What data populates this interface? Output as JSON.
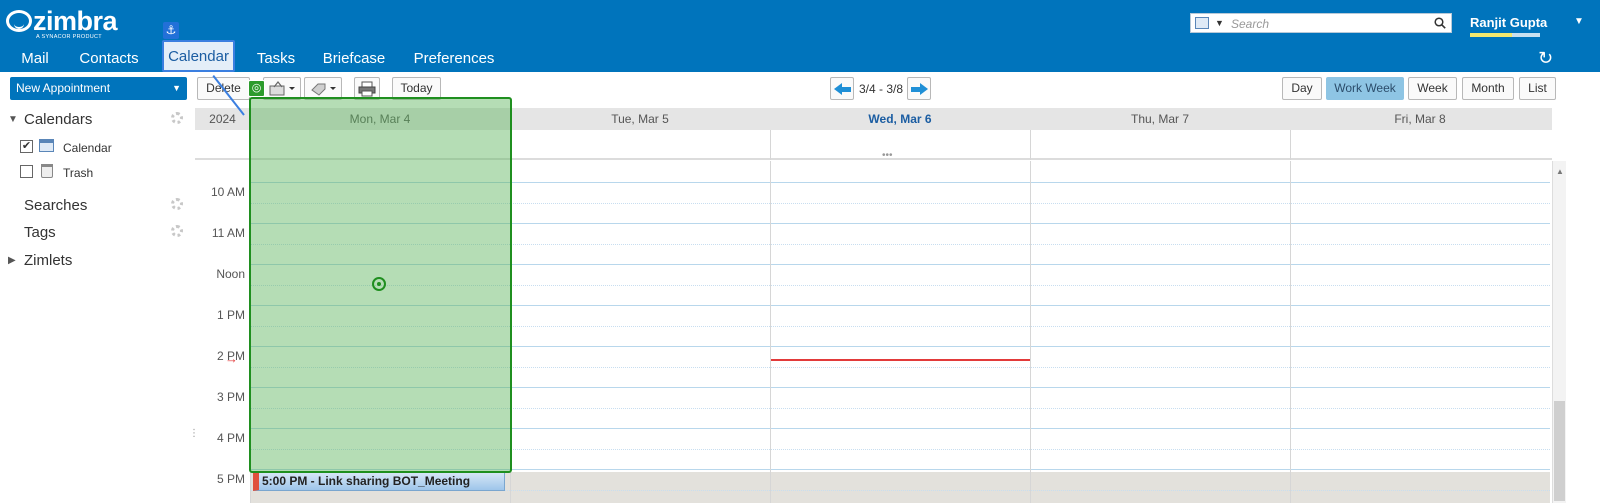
{
  "brand": {
    "name": "zimbra",
    "tagline": "A SYNACOR PRODUCT"
  },
  "header": {
    "search_placeholder": "Search",
    "user_name": "Ranjit Gupta",
    "quota_fraction": 0.6
  },
  "app_tabs": [
    "Mail",
    "Contacts",
    "Calendar",
    "Tasks",
    "Briefcase",
    "Preferences"
  ],
  "active_tab": "Calendar",
  "sidebar": {
    "new_button": "New Appointment",
    "calendars_header": "Calendars",
    "calendars": [
      {
        "label": "Calendar",
        "checked": true
      },
      {
        "label": "Trash",
        "checked": false
      }
    ],
    "searches_header": "Searches",
    "tags_header": "Tags",
    "zimlets_header": "Zimlets"
  },
  "toolbar": {
    "delete": "Delete",
    "today": "Today",
    "date_range": "3/4 - 3/8",
    "views": [
      "Day",
      "Work Week",
      "Week",
      "Month",
      "List"
    ],
    "active_view": "Work Week"
  },
  "calendar": {
    "year": "2024",
    "days": [
      "Mon, Mar 4",
      "Tue, Mar 5",
      "Wed, Mar 6",
      "Thu, Mar 7",
      "Fri, Mar 8"
    ],
    "today": "Wed, Mar 6",
    "hours": [
      "10 AM",
      "11 AM",
      "Noon",
      "1 PM",
      "2 PM",
      "3 PM",
      "4 PM",
      "5 PM"
    ],
    "events": [
      {
        "title": "5:00 PM - Link sharing BOT_Meeting",
        "day": "Mon, Mar 4",
        "start": "5:00 PM",
        "color": "#e0503c"
      }
    ]
  }
}
